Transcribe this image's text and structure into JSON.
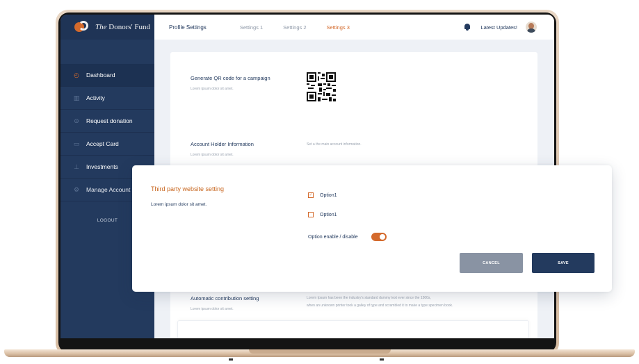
{
  "app": {
    "logo_prefix": "The",
    "logo_name": "Donors' Fund"
  },
  "sidebar": {
    "items": [
      {
        "label": "Dashboard",
        "icon": "gauge-icon"
      },
      {
        "label": "Activity",
        "icon": "bar-chart-icon"
      },
      {
        "label": "Request donation",
        "icon": "hand-coin-icon"
      },
      {
        "label": "Accept Card",
        "icon": "credit-card-icon"
      },
      {
        "label": "Investments",
        "icon": "growth-icon"
      },
      {
        "label": "Manage Account",
        "icon": "gear-icon"
      }
    ],
    "logout": "LOGOUT"
  },
  "header": {
    "tabs": [
      "Profile Settings",
      "Settings 1",
      "Settings 2",
      "Settings 3"
    ],
    "active_tab": "Settings 3",
    "latest_updates": "Latest Updates!"
  },
  "content": {
    "qr": {
      "title": "Generate QR code for a campaign",
      "subtitle": "Lorem ipsum dolor sit amet."
    },
    "account_holder": {
      "title": "Account Holder Information",
      "subtitle": "Lorem ipsum dolor sit amet.",
      "note": "Set a the main account information."
    },
    "auto_contribution": {
      "title": "Automatic contribution setting",
      "subtitle": "Lorem ipsum dolor sit amet.",
      "desc_line1": "Lorem Ipsum has been the industry's standard dummy text ever since the 1500s,",
      "desc_line2": "when an unknown printer took a galley of type and scrambled it to make a type specimen book."
    }
  },
  "modal": {
    "title": "Third party website setting",
    "subtitle": "Lorem ipsum dolor sit amet.",
    "option1_label": "Option1",
    "option1_checked": true,
    "option2_label": "Option1",
    "option2_checked": false,
    "toggle_label": "Option enable / disable",
    "toggle_on": true,
    "cancel": "CANCEL",
    "save": "SAVE"
  },
  "colors": {
    "navy": "#233a5e",
    "accent": "#d46a2c",
    "cancel_gray": "#8993a3"
  }
}
